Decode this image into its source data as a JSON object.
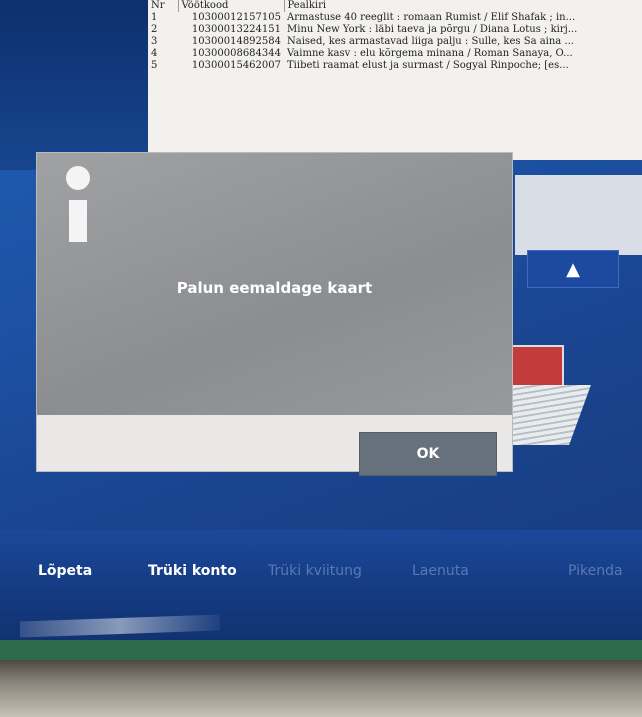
{
  "report": {
    "headers": [
      "Nr",
      "Vöötkood",
      "Pealkiri"
    ],
    "rows": [
      {
        "nr": "1",
        "code": "10300012157105",
        "title": "Armastuse 40 reeglit : romaan Rumist / Elif Shafak ; in..."
      },
      {
        "nr": "2",
        "code": "10300013224151",
        "title": "Minu New York : läbi taeva ja põrgu / Diana Lotus ; kirj..."
      },
      {
        "nr": "3",
        "code": "10300014892584",
        "title": "Naised, kes armastavad liiga palju : Sulle, kes Sa aina ..."
      },
      {
        "nr": "4",
        "code": "10300008684344",
        "title": "Vaimne kasv : elu kõrgema minana / Roman Sanaya, O..."
      },
      {
        "nr": "5",
        "code": "10300015462007",
        "title": "Tiibeti raamat elust ja surmast / Sogyal Rinpoche; [es..."
      }
    ]
  },
  "dialog": {
    "message": "Palun eemaldage kaart",
    "ok_label": "OK",
    "icon": "info-icon"
  },
  "menu": {
    "items": [
      {
        "label": "Lõpeta",
        "enabled": true
      },
      {
        "label": "Trüki konto",
        "enabled": true
      },
      {
        "label": "Trüki kviitung",
        "enabled": false
      },
      {
        "label": "Laenuta",
        "enabled": false
      },
      {
        "label": "Pikenda",
        "enabled": false
      }
    ]
  },
  "panel": {
    "scroll_up_icon": "triangle-up-icon"
  },
  "colors": {
    "screen_blue": "#1d52a6",
    "dialog_gray": "#8e9093",
    "ok_button": "#66717d",
    "disabled_text": "#5a79b3"
  }
}
